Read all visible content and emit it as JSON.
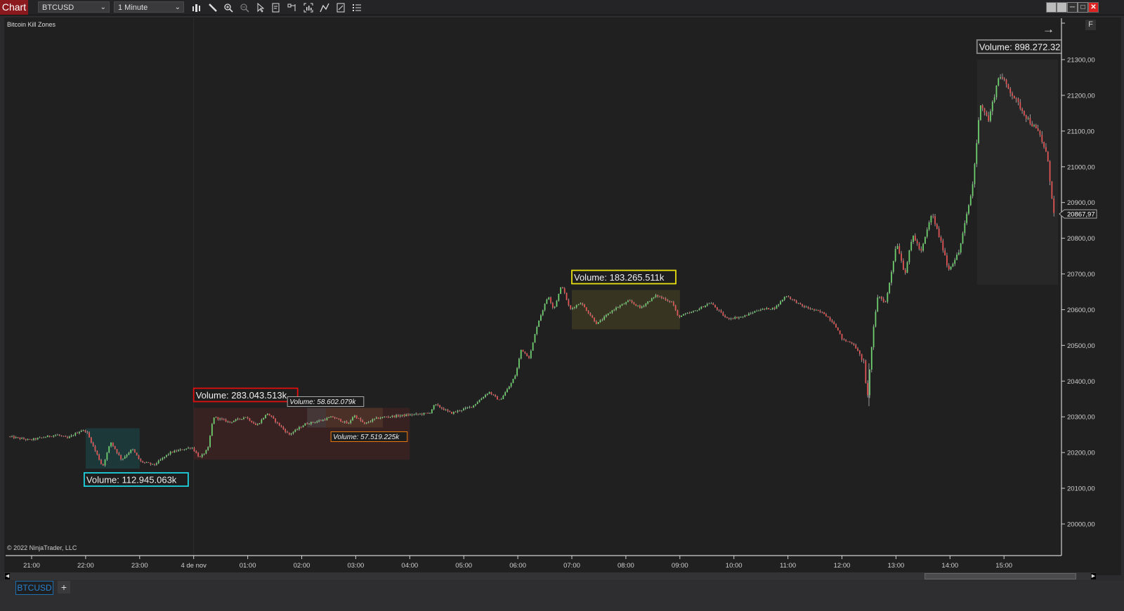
{
  "window": {
    "tab_label": "Chart",
    "instrument": "BTCUSD",
    "interval": "1 Minute",
    "toolbar_icons": [
      "bar-type-icon",
      "drawing-tools-icon",
      "zoom-in-icon",
      "zoom-out-icon",
      "pointer-icon",
      "data-box-icon",
      "chart-trader-icon",
      "indicators-icon",
      "strategies-icon",
      "properties-icon",
      "object-list-icon"
    ],
    "window_buttons": [
      "tile-icon",
      "tile-icon",
      "minimize-icon",
      "maximize-icon",
      "close-icon"
    ],
    "f_button": "F",
    "arrow_glyph": "→"
  },
  "panel": {
    "label": "Bitcoin Kill Zones",
    "copyright": "© 2022 NinjaTrader, LLC"
  },
  "bottom": {
    "instrument_tab": "BTCUSD",
    "add_tab": "+"
  },
  "chart_data": {
    "type": "candlestick",
    "title": "Bitcoin Kill Zones",
    "instrument": "BTCUSD",
    "interval": "1 Minute",
    "last_price": "20867,97",
    "last_price_value": 20867.97,
    "ylim": [
      19950,
      21340
    ],
    "y_ticks": [
      {
        "value": 21300,
        "label": "21300,00"
      },
      {
        "value": 21200,
        "label": "21200,00"
      },
      {
        "value": 21100,
        "label": "21100,00"
      },
      {
        "value": 21000,
        "label": "21000,00"
      },
      {
        "value": 20900,
        "label": "20900,00"
      },
      {
        "value": 20800,
        "label": "20800,00"
      },
      {
        "value": 20700,
        "label": "20700,00"
      },
      {
        "value": 20600,
        "label": "20600,00"
      },
      {
        "value": 20500,
        "label": "20500,00"
      },
      {
        "value": 20400,
        "label": "20400,00"
      },
      {
        "value": 20300,
        "label": "20300,00"
      },
      {
        "value": 20200,
        "label": "20200,00"
      },
      {
        "value": 20100,
        "label": "20100,00"
      },
      {
        "value": 20000,
        "label": "20000,00"
      }
    ],
    "xlim_hours": [
      20.5,
      40.0
    ],
    "x_ticks": [
      {
        "hour": 21,
        "label": "21:00"
      },
      {
        "hour": 22,
        "label": "22:00"
      },
      {
        "hour": 23,
        "label": "23:00"
      },
      {
        "hour": 24,
        "label": "4 de nov"
      },
      {
        "hour": 25,
        "label": "01:00"
      },
      {
        "hour": 26,
        "label": "02:00"
      },
      {
        "hour": 27,
        "label": "03:00"
      },
      {
        "hour": 28,
        "label": "04:00"
      },
      {
        "hour": 29,
        "label": "05:00"
      },
      {
        "hour": 30,
        "label": "06:00"
      },
      {
        "hour": 31,
        "label": "07:00"
      },
      {
        "hour": 32,
        "label": "08:00"
      },
      {
        "hour": 33,
        "label": "09:00"
      },
      {
        "hour": 34,
        "label": "10:00"
      },
      {
        "hour": 35,
        "label": "11:00"
      },
      {
        "hour": 36,
        "label": "12:00"
      },
      {
        "hour": 37,
        "label": "13:00"
      },
      {
        "hour": 38,
        "label": "14:00"
      },
      {
        "hour": 39,
        "label": "15:00"
      }
    ],
    "day_separator_hour": 24,
    "price_path": [
      [
        20.6,
        20245
      ],
      [
        21.0,
        20235
      ],
      [
        21.5,
        20250
      ],
      [
        21.7,
        20240
      ],
      [
        21.95,
        20262
      ],
      [
        22.05,
        20260
      ],
      [
        22.2,
        20210
      ],
      [
        22.35,
        20160
      ],
      [
        22.5,
        20230
      ],
      [
        22.7,
        20180
      ],
      [
        22.9,
        20210
      ],
      [
        23.05,
        20175
      ],
      [
        23.3,
        20165
      ],
      [
        23.6,
        20200
      ],
      [
        24.0,
        20215
      ],
      [
        24.15,
        20185
      ],
      [
        24.3,
        20210
      ],
      [
        24.4,
        20300
      ],
      [
        24.7,
        20285
      ],
      [
        25.0,
        20300
      ],
      [
        25.2,
        20275
      ],
      [
        25.4,
        20310
      ],
      [
        25.8,
        20250
      ],
      [
        26.1,
        20280
      ],
      [
        26.4,
        20290
      ],
      [
        26.6,
        20300
      ],
      [
        26.9,
        20280
      ],
      [
        27.0,
        20305
      ],
      [
        27.2,
        20280
      ],
      [
        27.4,
        20295
      ],
      [
        27.6,
        20300
      ],
      [
        28.0,
        20305
      ],
      [
        28.4,
        20310
      ],
      [
        28.5,
        20335
      ],
      [
        28.8,
        20310
      ],
      [
        29.2,
        20330
      ],
      [
        29.5,
        20370
      ],
      [
        29.7,
        20345
      ],
      [
        29.9,
        20390
      ],
      [
        30.0,
        20420
      ],
      [
        30.1,
        20490
      ],
      [
        30.25,
        20465
      ],
      [
        30.4,
        20560
      ],
      [
        30.6,
        20640
      ],
      [
        30.7,
        20600
      ],
      [
        30.85,
        20670
      ],
      [
        31.0,
        20600
      ],
      [
        31.2,
        20620
      ],
      [
        31.5,
        20560
      ],
      [
        31.8,
        20600
      ],
      [
        32.1,
        20625
      ],
      [
        32.3,
        20605
      ],
      [
        32.6,
        20640
      ],
      [
        32.9,
        20620
      ],
      [
        33.0,
        20580
      ],
      [
        33.3,
        20595
      ],
      [
        33.6,
        20620
      ],
      [
        33.9,
        20575
      ],
      [
        34.2,
        20580
      ],
      [
        34.5,
        20600
      ],
      [
        34.8,
        20605
      ],
      [
        35.0,
        20640
      ],
      [
        35.3,
        20610
      ],
      [
        35.7,
        20590
      ],
      [
        35.9,
        20560
      ],
      [
        36.05,
        20515
      ],
      [
        36.25,
        20505
      ],
      [
        36.45,
        20450
      ],
      [
        36.5,
        20340
      ],
      [
        36.6,
        20520
      ],
      [
        36.7,
        20640
      ],
      [
        36.85,
        20620
      ],
      [
        37.05,
        20790
      ],
      [
        37.2,
        20700
      ],
      [
        37.35,
        20810
      ],
      [
        37.5,
        20760
      ],
      [
        37.7,
        20870
      ],
      [
        37.95,
        20750
      ],
      [
        38.0,
        20710
      ],
      [
        38.2,
        20760
      ],
      [
        38.45,
        20940
      ],
      [
        38.6,
        21180
      ],
      [
        38.75,
        21130
      ],
      [
        38.95,
        21260
      ],
      [
        39.2,
        21200
      ],
      [
        39.45,
        21140
      ],
      [
        39.7,
        21090
      ],
      [
        39.85,
        21020
      ],
      [
        39.95,
        20868
      ]
    ],
    "kill_zones": [
      {
        "name": "zone-asia-cyan",
        "start_hour": 22.0,
        "end_hour": 23.0,
        "high": 20268,
        "low": 20155,
        "fill": "#1e3a3a",
        "label": "Volume: 112.945.063k",
        "label_color": "#1fd3e0",
        "label_pos": "below",
        "font": "normal"
      },
      {
        "name": "zone-london-red",
        "start_hour": 24.0,
        "end_hour": 28.0,
        "high": 20325,
        "low": 20180,
        "fill": "#3a2222",
        "label": "Volume: 283.043.513k",
        "label_color": "#e01010",
        "label_pos": "above",
        "font": "normal"
      },
      {
        "name": "zone-grey-small",
        "start_hour": 26.1,
        "end_hour": 26.45,
        "high": 20325,
        "low": 20270,
        "fill": "#46393a",
        "label": "Volume: 58.602.079k",
        "label_color": "#aaaaaa",
        "label_pos": "above-small",
        "font": "italic"
      },
      {
        "name": "zone-orange",
        "start_hour": 26.45,
        "end_hour": 27.5,
        "high": 20325,
        "low": 20270,
        "fill": "#4c3128",
        "label": "Volume: 57.519.225k",
        "label_color": "#e87a10",
        "label_pos": "below-small",
        "font": "italic"
      },
      {
        "name": "zone-ny-yellow",
        "start_hour": 31.0,
        "end_hour": 33.0,
        "high": 20655,
        "low": 20545,
        "fill": "#393723",
        "label": "Volume: 183.265.511k",
        "label_color": "#e8e010",
        "label_pos": "above",
        "font": "normal"
      },
      {
        "name": "zone-current-grey",
        "start_hour": 38.5,
        "end_hour": 40.0,
        "high": 21300,
        "low": 20670,
        "fill": "#282828",
        "label": "Volume: 898.272.32",
        "label_color": "#888888",
        "label_pos": "above",
        "font": "normal"
      }
    ],
    "colors": {
      "up": "#6fcf6f",
      "down": "#e05555",
      "wick": "#c8c8c8",
      "background": "#202021",
      "axis": "#cfcfcf"
    },
    "grid": false
  }
}
